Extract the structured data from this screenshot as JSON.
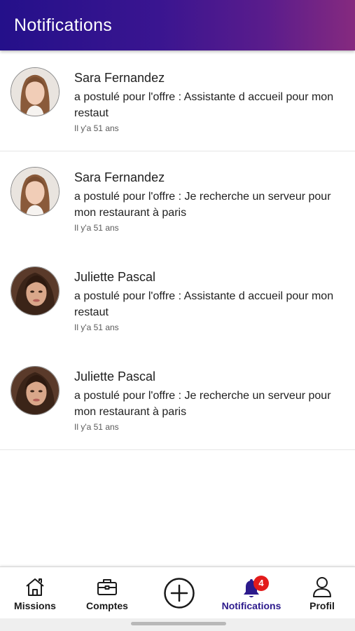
{
  "header": {
    "title": "Notifications"
  },
  "notifications": [
    {
      "name": "Sara Fernandez",
      "message": "a postulé pour l'offre : Assistante d accueil pour mon restaut",
      "time": "Il y'a 51 ans"
    },
    {
      "name": "Sara Fernandez",
      "message": "a postulé pour l'offre : Je recherche un serveur pour mon restaurant à paris",
      "time": "Il y'a 51 ans"
    },
    {
      "name": "Juliette Pascal",
      "message": "a postulé pour l'offre : Assistante d accueil pour mon restaut",
      "time": "Il y'a 51 ans"
    },
    {
      "name": "Juliette Pascal",
      "message": "a postulé pour l'offre : Je recherche un serveur pour mon restaurant à paris",
      "time": "Il y'a 51 ans"
    }
  ],
  "tabbar": {
    "items": [
      {
        "label": "Missions",
        "icon": "home-icon"
      },
      {
        "label": "Comptes",
        "icon": "briefcase-icon"
      },
      {
        "label": "",
        "icon": "plus-circle-icon"
      },
      {
        "label": "Notifications",
        "icon": "bell-icon",
        "badge": "4",
        "active": true
      },
      {
        "label": "Profil",
        "icon": "person-icon"
      }
    ]
  },
  "colors": {
    "header_gradient_start": "#24108a",
    "header_gradient_end": "#862a7f",
    "active_tab": "#2c1a8c",
    "badge": "#e31b1b"
  }
}
